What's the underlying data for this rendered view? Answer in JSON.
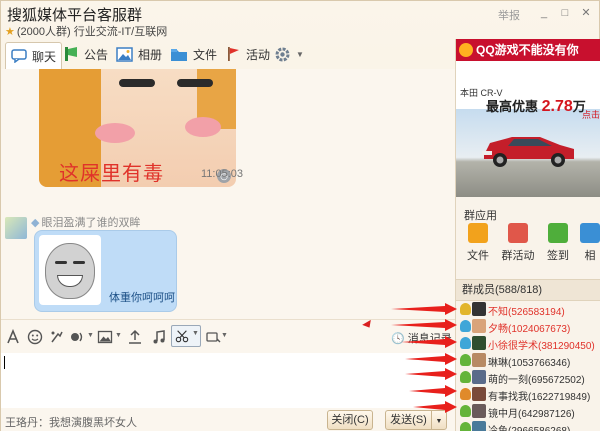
{
  "window": {
    "title": "搜狐媒体平台客服群",
    "subtitle": "(2000人群) 行业交流-IT/互联网",
    "report_label": "举报",
    "controls": [
      "_",
      "□",
      "✕"
    ]
  },
  "tabs": [
    {
      "label": "聊天",
      "icon": "chat-icon",
      "active": true
    },
    {
      "label": "公告",
      "icon": "announcement-icon"
    },
    {
      "label": "相册",
      "icon": "album-icon"
    },
    {
      "label": "文件",
      "icon": "folder-icon"
    },
    {
      "label": "活动",
      "icon": "flag-icon"
    },
    {
      "label": "",
      "icon": "settings-gear-icon"
    }
  ],
  "chat": {
    "messages": [
      {
        "type": "image",
        "caption": "这屎里有毒",
        "timestamp": "11:05:03"
      },
      {
        "type": "image-text",
        "sender": "眼泪盈满了谁的双眸",
        "text": "体重你呵呵呵"
      }
    ]
  },
  "toolbar": {
    "icons": [
      "font-icon",
      "emoji-icon",
      "shake-icon",
      "voice-icon",
      "image-icon",
      "upload-icon",
      "music-icon",
      "screenshot-icon",
      "more-icon"
    ],
    "history_label": "消息记录"
  },
  "input": {
    "value": ""
  },
  "footer": {
    "tip": "王珞丹：我想演腹黑坏女人",
    "close_label": "关闭(C)",
    "send_label": "发送(S)"
  },
  "sidebar": {
    "ad": {
      "banner": "QQ游戏不能没有你",
      "car_line": "本田 CR-V",
      "promo_prefix": "最高优惠",
      "promo_value": "2.78",
      "promo_unit": "万",
      "click_label": "点击"
    },
    "apps_title": "群应用",
    "apps": [
      {
        "label": "文件",
        "color": "#f2a21c"
      },
      {
        "label": "群活动",
        "color": "#e0574a"
      },
      {
        "label": "签到",
        "color": "#4fae3b"
      },
      {
        "label": "相",
        "color": "#3a8fd5"
      }
    ],
    "members_title": "群成员(588/818)",
    "members": [
      {
        "name": "不知(526583194)",
        "color": "#e0322a",
        "rank": "#e2b52a",
        "avatar": "#333"
      },
      {
        "name": "夕畅(1024067673)",
        "color": "#e0322a",
        "rank": "#3fa6d8",
        "avatar": "#d9a47a"
      },
      {
        "name": "小徐很学术(381290450)",
        "color": "#e0322a",
        "rank": "#3fa6d8",
        "avatar": "#2f4f2f"
      },
      {
        "name": "琳琳(1053766346)",
        "color": "#333333",
        "rank": "#64b43a",
        "avatar": "#b88a64"
      },
      {
        "name": "萌的一刻(695672502)",
        "color": "#333333",
        "rank": "#64b43a",
        "avatar": "#5a6b8a"
      },
      {
        "name": "有事找我(1622719849)",
        "color": "#333333",
        "rank": "#e08a2a",
        "avatar": "#7a4a3a"
      },
      {
        "name": "镜中月(642987126)",
        "color": "#333333",
        "rank": "#64b43a",
        "avatar": "#6a5a5a"
      },
      {
        "name": "冷鱼(2966586268)",
        "color": "#333333",
        "rank": "#64b43a",
        "avatar": "#4a7a9a"
      }
    ]
  },
  "colors": {
    "accent": "#e0322a",
    "bubble": "#bfdcf7",
    "annotation_arrow": "#e8201c"
  }
}
